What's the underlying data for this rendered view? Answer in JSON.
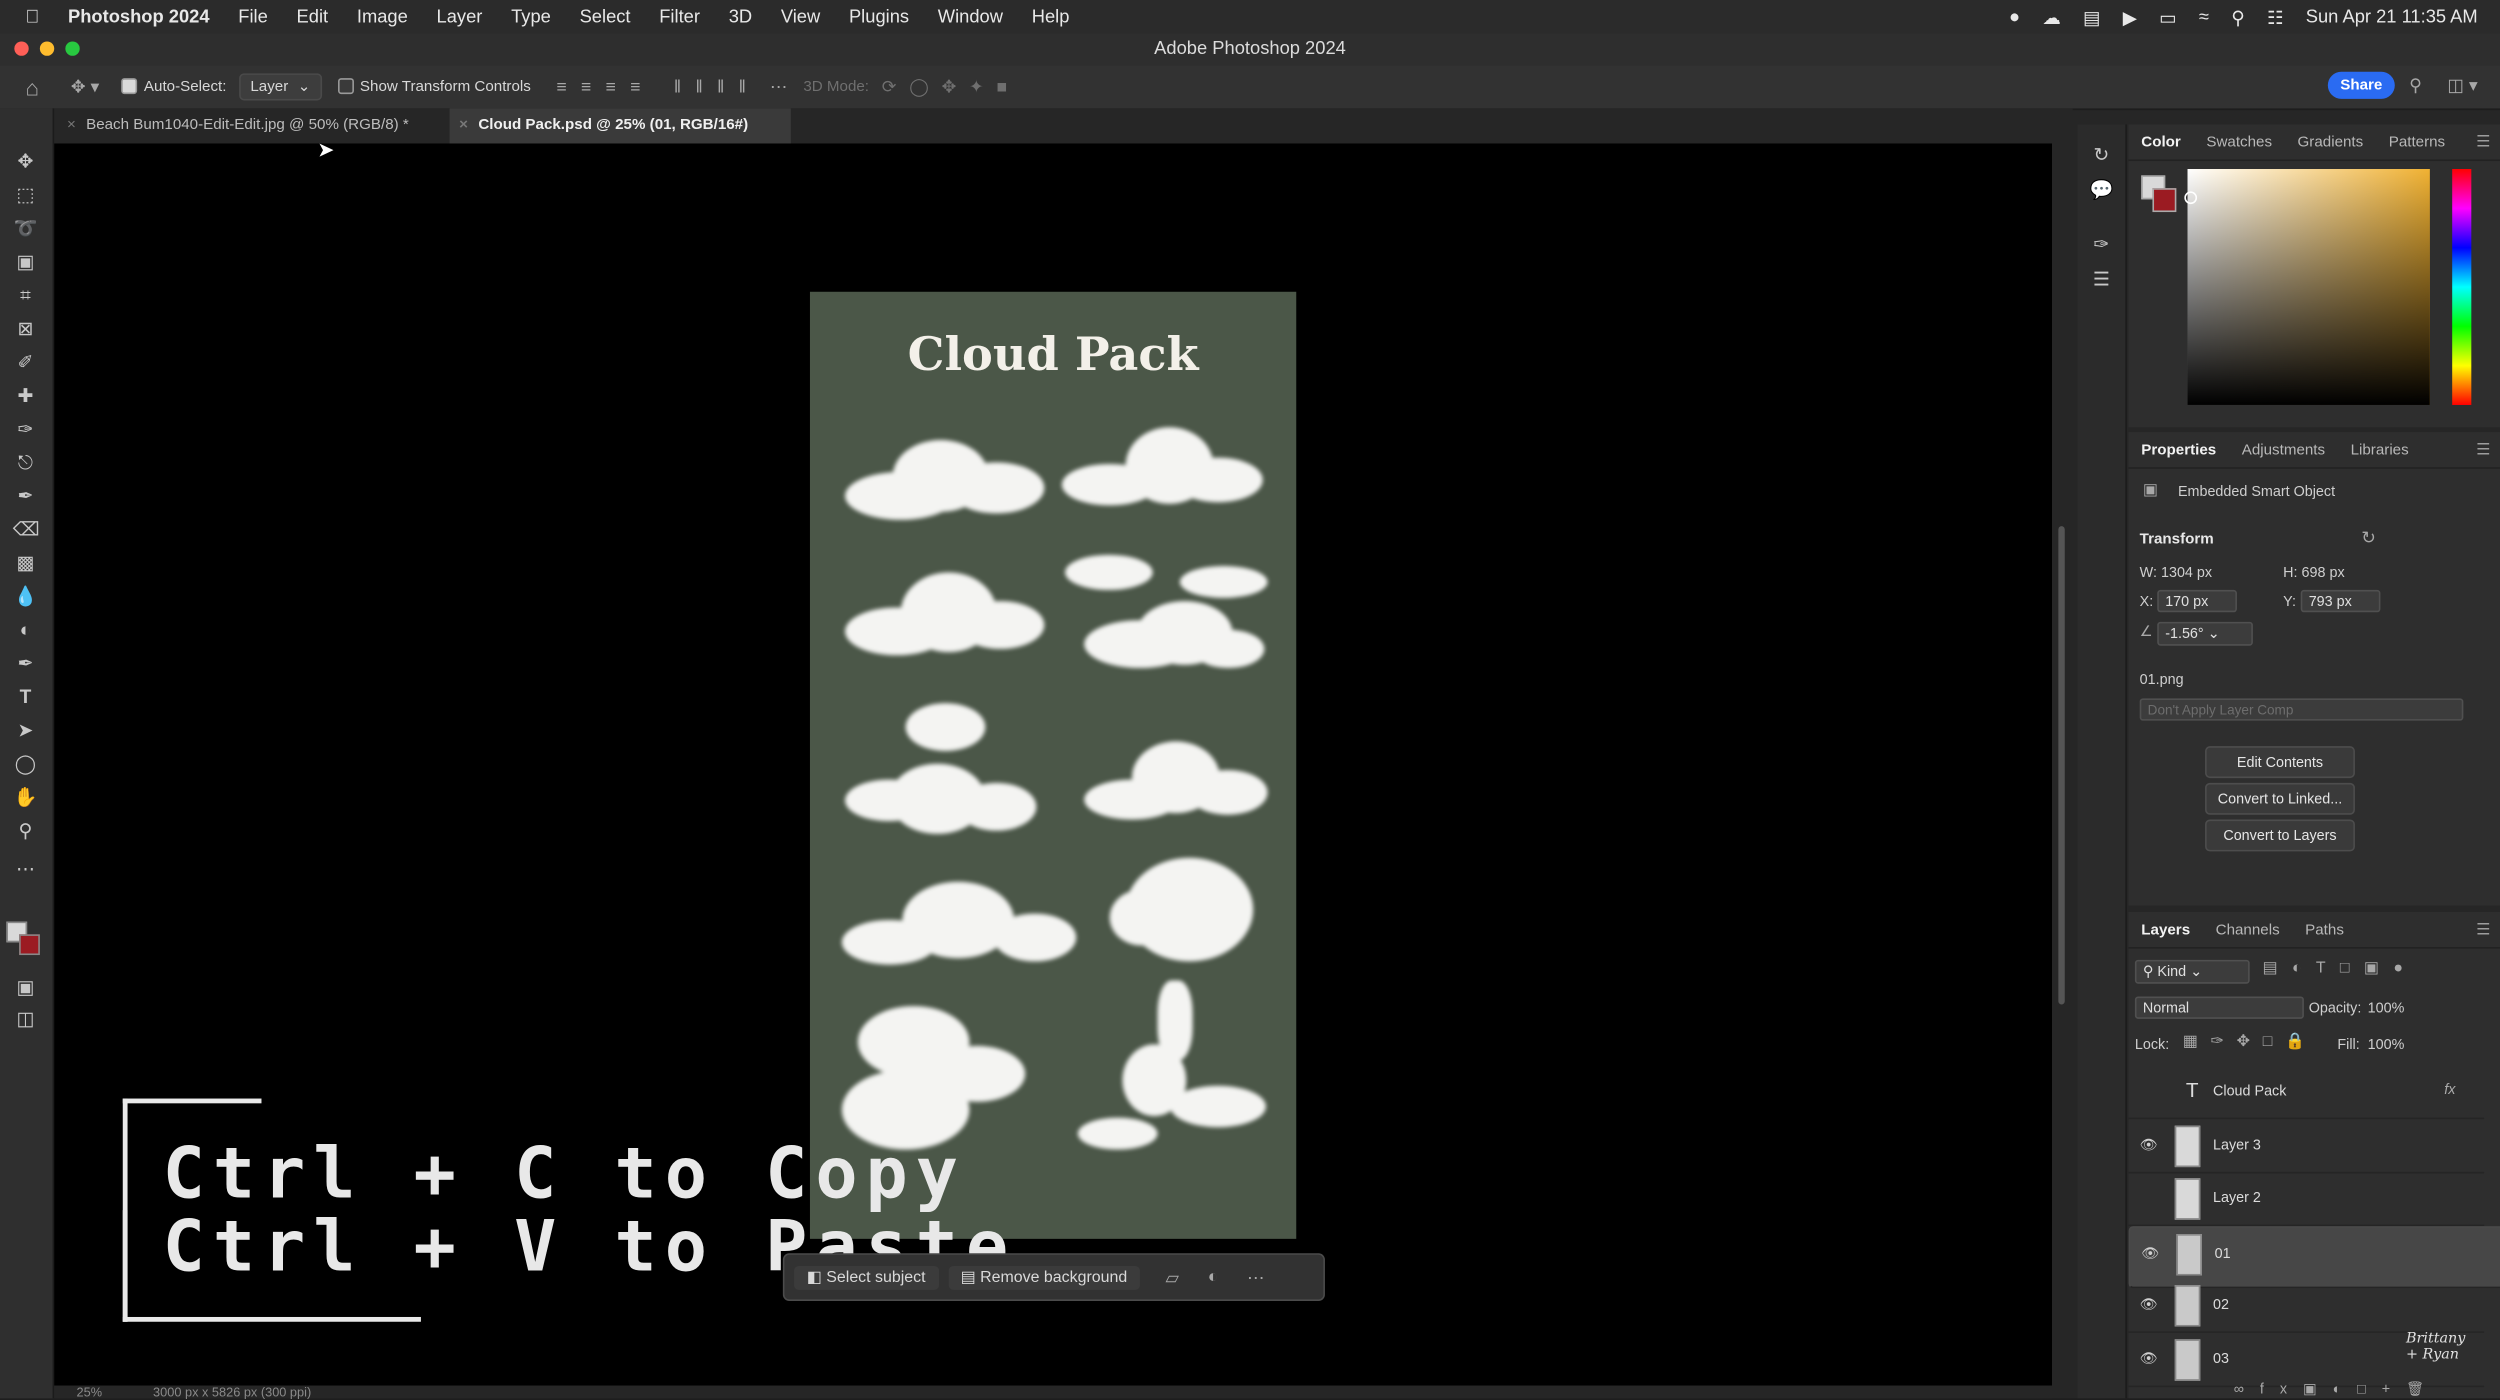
{
  "menubar": {
    "apple": "",
    "app": "Photoshop 2024",
    "items": [
      "File",
      "Edit",
      "Image",
      "Layer",
      "Type",
      "Select",
      "Filter",
      "3D",
      "View",
      "Plugins",
      "Window",
      "Help"
    ],
    "clock": "Sun Apr 21  11:35 AM"
  },
  "window": {
    "title": "Adobe Photoshop 2024"
  },
  "options": {
    "auto_select_label": "Auto-Select:",
    "auto_select_value": "Layer",
    "transform_label": "Show Transform Controls",
    "mode_label": "3D Mode:",
    "share": "Share"
  },
  "tabs": [
    {
      "label": "Beach Bum1040-Edit-Edit.jpg @ 50% (RGB/8) *"
    },
    {
      "label": "Cloud Pack.psd @ 25% (01, RGB/16#)"
    }
  ],
  "document": {
    "title": "Cloud Pack"
  },
  "taskbar": {
    "select_subject": "Select subject",
    "remove_background": "Remove background"
  },
  "caption": {
    "line1": "Ctrl + C to Copy",
    "line2": "Ctrl + V to Paste"
  },
  "status": {
    "zoom": "25%",
    "size": "3000 px x 5826 px (300 ppi)"
  },
  "color_panel": {
    "tabs": [
      "Color",
      "Swatches",
      "Gradients",
      "Patterns"
    ],
    "foreground": "#d9d9d9",
    "background": "#9b1b22"
  },
  "properties": {
    "tabs": [
      "Properties",
      "Adjustments",
      "Libraries"
    ],
    "type": "Embedded Smart Object",
    "section": "Transform",
    "w_label": "W:",
    "w": "1304 px",
    "h_label": "H:",
    "h": "698 px",
    "x_label": "X:",
    "x": "170 px",
    "y_label": "Y:",
    "y": "793 px",
    "angle": "-1.56°",
    "file": "01.png",
    "layer_comp": "Don't Apply Layer Comp",
    "buttons": [
      "Edit Contents",
      "Convert to Linked...",
      "Convert to Layers"
    ]
  },
  "layers_panel": {
    "tabs": [
      "Layers",
      "Channels",
      "Paths"
    ],
    "kind": "Kind",
    "blend": "Normal",
    "opacity_label": "Opacity:",
    "opacity": "100%",
    "lock_label": "Lock:",
    "fill_label": "Fill:",
    "fill": "100%",
    "layers": [
      {
        "name": "Cloud Pack",
        "visible": false,
        "selected": false,
        "type": "text"
      },
      {
        "name": "Layer 3",
        "visible": true,
        "selected": false,
        "type": "pixel"
      },
      {
        "name": "Layer 2",
        "visible": false,
        "selected": false,
        "type": "pixel"
      },
      {
        "name": "01",
        "visible": true,
        "selected": true,
        "type": "smart"
      },
      {
        "name": "02",
        "visible": true,
        "selected": false,
        "type": "smart"
      },
      {
        "name": "03",
        "visible": true,
        "selected": false,
        "type": "smart"
      }
    ]
  },
  "watermark": {
    "line1": "Brittany",
    "line2": "+ Ryan"
  }
}
